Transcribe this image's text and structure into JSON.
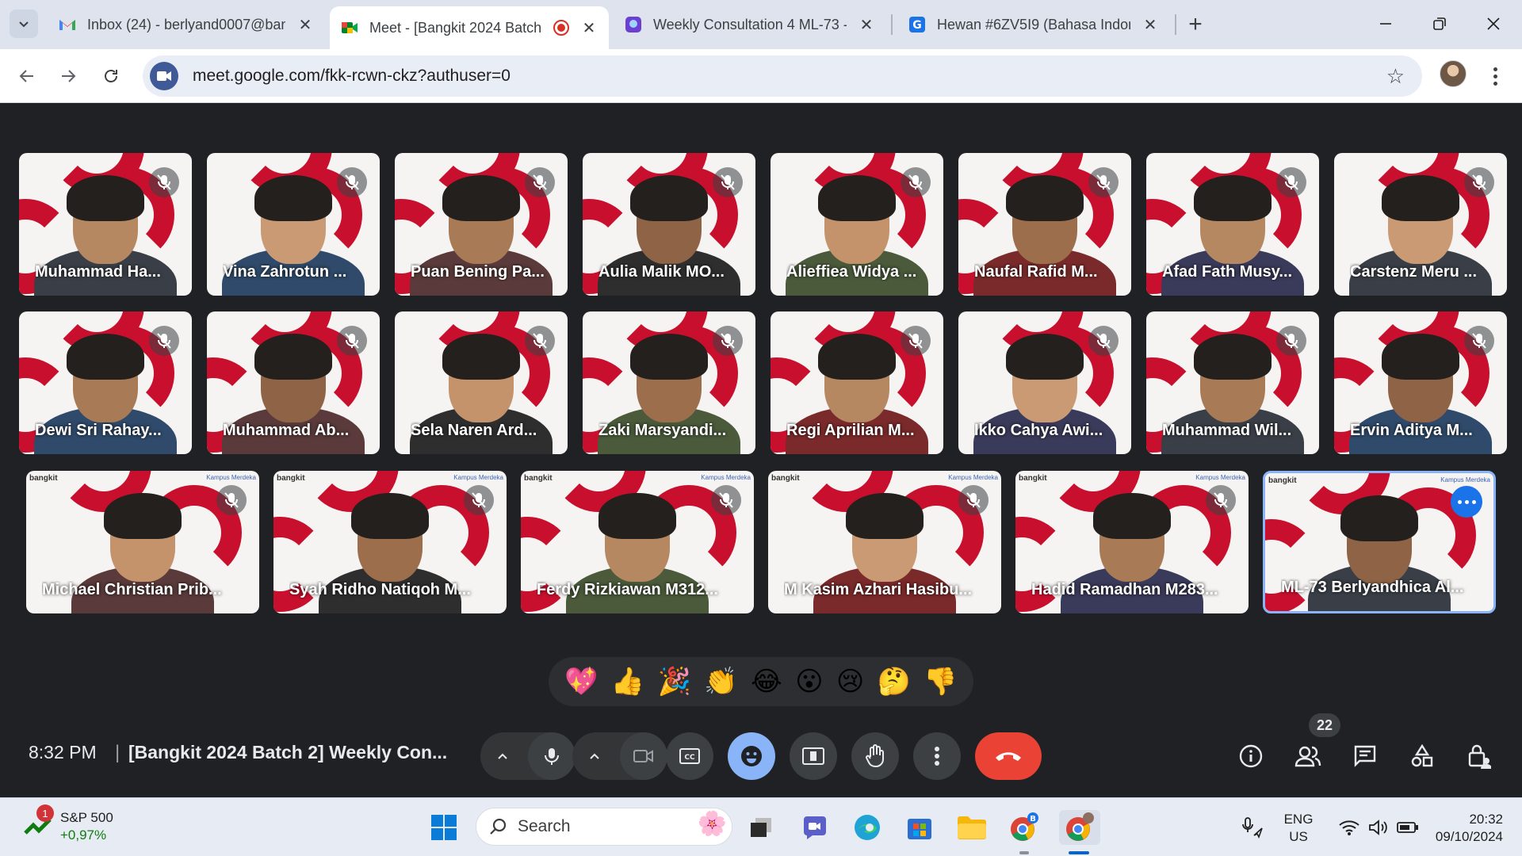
{
  "browser": {
    "tabs": [
      {
        "title": "Inbox (24) - berlyand0007@ban",
        "icon": "gmail-icon"
      },
      {
        "title": "Meet - [Bangkit 2024 Batch",
        "icon": "meet-icon",
        "active": true,
        "recording": true
      },
      {
        "title": "Weekly Consultation 4 ML-73 -",
        "icon": "app-icon"
      },
      {
        "title": "Hewan #6ZV5I9 (Bahasa Indone",
        "icon": "g-icon"
      }
    ],
    "url": "meet.google.com/fkk-rcwn-ckz?authuser=0"
  },
  "participants": [
    {
      "name": "Muhammad Ha..."
    },
    {
      "name": "Vina Zahrotun ..."
    },
    {
      "name": "Puan Bening Pa..."
    },
    {
      "name": "Aulia Malik MO..."
    },
    {
      "name": "Alieffiea Widya ..."
    },
    {
      "name": "Naufal Rafid M..."
    },
    {
      "name": "Afad Fath Musy..."
    },
    {
      "name": "Carstenz Meru ..."
    },
    {
      "name": "Dewi Sri Rahay..."
    },
    {
      "name": "Muhammad Ab..."
    },
    {
      "name": "Sela Naren Ard..."
    },
    {
      "name": "Zaki Marsyandi..."
    },
    {
      "name": "Regi Aprilian M..."
    },
    {
      "name": "Ikko Cahya Awi..."
    },
    {
      "name": "Muhammad Wil..."
    },
    {
      "name": "Ervin Aditya M..."
    },
    {
      "name": "Michael Christian Prib..."
    },
    {
      "name": "Syah Ridho Natiqoh M..."
    },
    {
      "name": "Ferdy Rizkiawan M312..."
    },
    {
      "name": "M Kasim Azhari Hasibu..."
    },
    {
      "name": "Hadid Ramadhan M283..."
    },
    {
      "name": "ML-73 Berlyandhica Al..."
    }
  ],
  "tile_brand": {
    "left": "bangkit",
    "right": "Kampus Merdeka"
  },
  "reactions": [
    "💖",
    "👍",
    "🎉",
    "👏",
    "😂",
    "😮",
    "😢",
    "🤔",
    "👎"
  ],
  "meeting": {
    "time": "8:32 PM",
    "separator": "|",
    "title": "[Bangkit 2024 Batch 2] Weekly Con...",
    "people_count": "22"
  },
  "taskbar": {
    "widget_badge": "1",
    "widget_name": "S&P 500",
    "widget_change": "+0,97%",
    "search_placeholder": "Search",
    "lang_top": "ENG",
    "lang_bottom": "US",
    "time": "20:32",
    "date": "09/10/2024"
  },
  "colors": {
    "meet_bg": "#202124",
    "hangup": "#ea4335",
    "accent": "#8ab4f8",
    "brand_red": "#c8102e"
  }
}
